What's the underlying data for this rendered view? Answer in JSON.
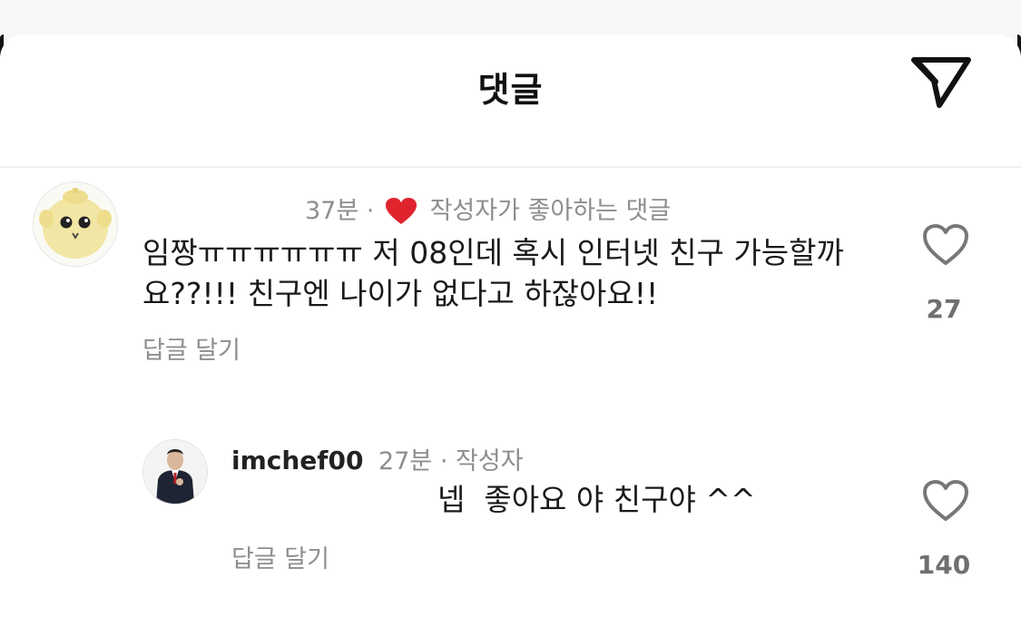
{
  "header": {
    "title": "댓글",
    "share_icon": "send-icon"
  },
  "comments": [
    {
      "avatar": "yellow-character-avatar",
      "time": "37분",
      "separator": "·",
      "liked_by_author_icon": "heart-icon",
      "liked_by_author_label": "작성자가 좋아하는 댓글",
      "text": "임짱ㅠㅠㅠㅠㅠㅠ 저 08인데 혹시 인터넷 친구 가능할까\n요??!!! 친구엔 나이가 없다고 하잖아요!!",
      "reply_label": "답글 달기",
      "like_icon": "heart-outline-icon",
      "like_count": "27"
    }
  ],
  "reply": {
    "avatar": "man-in-suit-avatar",
    "username": "imchef00",
    "time": "27분",
    "separator": "·",
    "author_badge": "작성자",
    "text": "넵  좋아요 야 친구야 ^^",
    "reply_label": "답글 달기",
    "like_icon": "heart-outline-icon",
    "like_count": "140"
  },
  "colors": {
    "heart_red": "#e0242e",
    "muted_text": "#8e8e8e",
    "background": "#ffffff"
  }
}
